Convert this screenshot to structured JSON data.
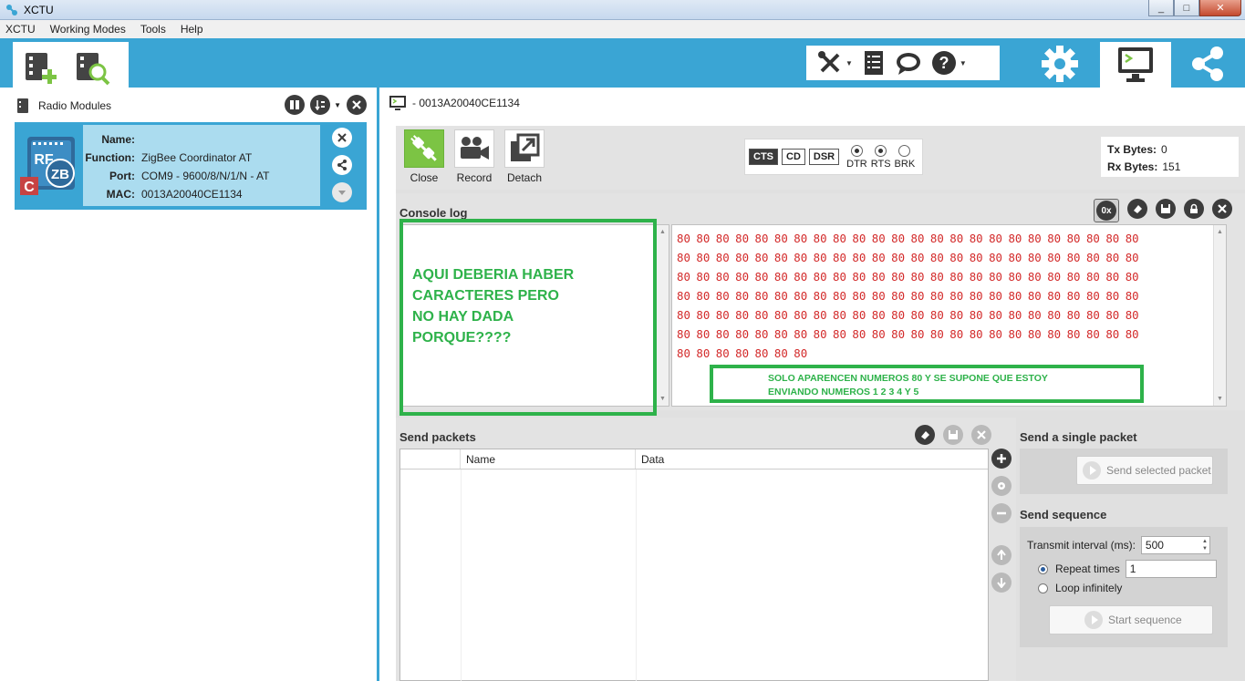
{
  "window": {
    "title": "XCTU",
    "min": "_",
    "max": "□",
    "close": "✕"
  },
  "menu": [
    "XCTU",
    "Working Modes",
    "Tools",
    "Help"
  ],
  "toolbar": {
    "caret": "▼"
  },
  "radio_modules": {
    "title": "Radio Modules",
    "module": {
      "badge_rf": "RF",
      "badge_zb": "ZB",
      "badge_c": "C",
      "name_label": "Name:",
      "name_value": "",
      "function_label": "Function:",
      "function_value": "ZigBee Coordinator AT",
      "port_label": "Port:",
      "port_value": "COM9 - 9600/8/N/1/N - AT",
      "mac_label": "MAC:",
      "mac_value": "0013A20040CE1134"
    }
  },
  "console": {
    "connection_title": "- 0013A20040CE1134",
    "buttons": {
      "close": "Close",
      "record": "Record",
      "detach": "Detach"
    },
    "signals": {
      "cts": "CTS",
      "cd": "CD",
      "dsr": "DSR",
      "dtr": "DTR",
      "rts": "RTS",
      "brk": "BRK"
    },
    "tx_label": "Tx Bytes:",
    "tx_value": "0",
    "rx_label": "Rx Bytes:",
    "rx_value": "151",
    "log_title": "Console log",
    "hex_toggle": "0x",
    "hex_lines": [
      "80 80 80 80 80 80 80 80 80 80 80 80 80 80 80 80 80 80 80 80 80 80 80 80",
      "80 80 80 80 80 80 80 80 80 80 80 80 80 80 80 80 80 80 80 80 80 80 80 80",
      "80 80 80 80 80 80 80 80 80 80 80 80 80 80 80 80 80 80 80 80 80 80 80 80",
      "80 80 80 80 80 80 80 80 80 80 80 80 80 80 80 80 80 80 80 80 80 80 80 80",
      "80 80 80 80 80 80 80 80 80 80 80 80 80 80 80 80 80 80 80 80 80 80 80 80",
      "80 80 80 80 80 80 80 80 80 80 80 80 80 80 80 80 80 80 80 80 80 80 80 80",
      "80 80 80 80 80 80 80"
    ]
  },
  "annotations": {
    "left_lines": [
      "AQUI DEBERIA HABER",
      "CARACTERES PERO",
      "NO HAY DADA",
      "PORQUE????"
    ],
    "right_lines": [
      "SOLO APARENCEN NUMEROS 80 Y SE SUPONE QUE ESTOY",
      "ENVIANDO NUMEROS 1 2 3 4 Y 5"
    ],
    "color": "#2eb24a"
  },
  "send_packets": {
    "title": "Send packets",
    "col_name": "Name",
    "col_data": "Data"
  },
  "single_packet": {
    "title": "Send a single packet",
    "button": "Send selected packet"
  },
  "sequence": {
    "title": "Send sequence",
    "interval_label": "Transmit interval (ms):",
    "interval_value": "500",
    "repeat_label": "Repeat times",
    "repeat_value": "1",
    "loop_label": "Loop infinitely",
    "start_button": "Start sequence"
  },
  "colors": {
    "accent": "#3aa5d4",
    "hex_text": "#d32a2a",
    "close_green": "#7cc444"
  }
}
